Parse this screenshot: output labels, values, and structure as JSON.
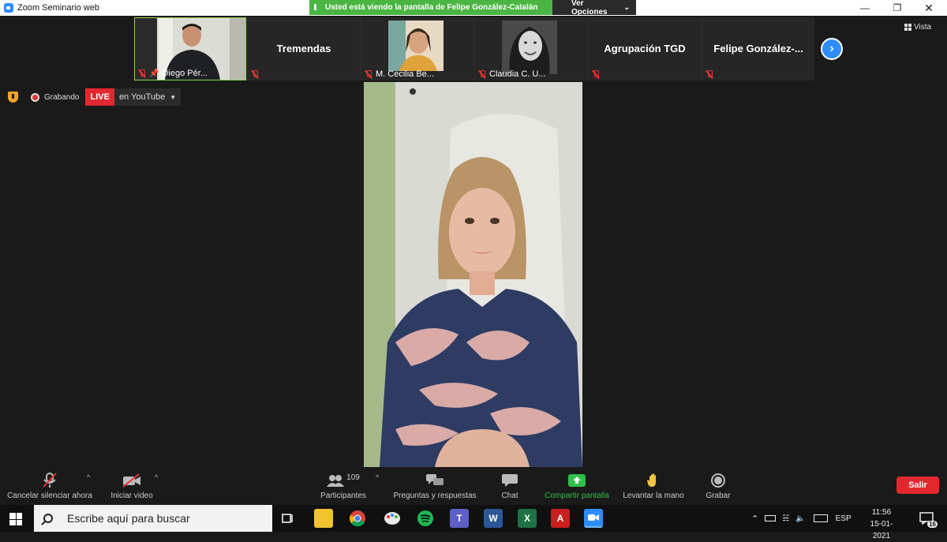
{
  "window": {
    "title": "Zoom Seminario web",
    "share_banner": "Usted está viendo la pantalla de Felipe González-Catalán",
    "view_options": "Ver Opciones"
  },
  "gallery": {
    "tiles": [
      {
        "name": "Diego Pér...",
        "type": "video"
      },
      {
        "name": "Tremendas",
        "type": "name"
      },
      {
        "name": "M. Cecilia Be...",
        "type": "video"
      },
      {
        "name": "Claudia C. U...",
        "type": "video"
      },
      {
        "name": "Agrupación TGD",
        "type": "name"
      },
      {
        "name": "Felipe  González-...",
        "type": "name"
      }
    ],
    "view_label": "Vista"
  },
  "recording": {
    "status": "Grabando",
    "live": "LIVE",
    "platform": "en YouTube"
  },
  "toolbar": {
    "unmute": "Cancelar silenciar ahora",
    "video": "Iniciar video",
    "participants": "Participantes",
    "participants_count": "109",
    "qa": "Preguntas y respuestas",
    "chat": "Chat",
    "share": "Compartir pantalla",
    "raise_hand": "Levantar la mano",
    "record": "Grabar",
    "leave": "Salir"
  },
  "taskbar": {
    "search_placeholder": "Escribe aquí para buscar",
    "language": "ESP",
    "time": "11:56",
    "date": "15-01-2021",
    "notifications": "16"
  },
  "colors": {
    "zoom_blue": "#2d8cff",
    "share_green": "#4bb543",
    "live_red": "#e0282e"
  }
}
